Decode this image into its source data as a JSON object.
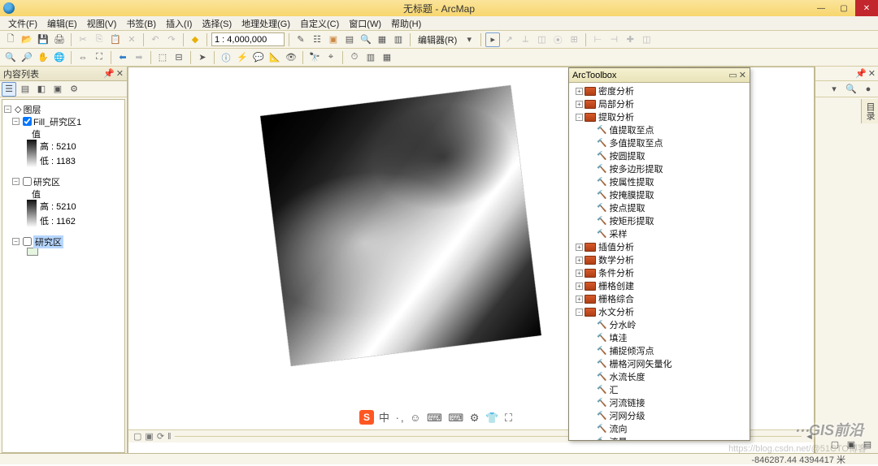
{
  "window": {
    "title": "无标题 - ArcMap",
    "min": "—",
    "max": "▢",
    "close": "✕"
  },
  "menu": [
    "文件(F)",
    "编辑(E)",
    "视图(V)",
    "书签(B)",
    "插入(I)",
    "选择(S)",
    "地理处理(G)",
    "自定义(C)",
    "窗口(W)",
    "帮助(H)"
  ],
  "toolbar1": {
    "scale": "1 : 4,000,000",
    "editor": "编辑器(R)"
  },
  "toc": {
    "title": "内容列表",
    "root": "图层",
    "layer1": {
      "name": "Fill_研究区1",
      "valLabel": "值",
      "highLabel": "高 : 5210",
      "lowLabel": "低 : 1183"
    },
    "layer2": {
      "name": "研究区",
      "valLabel": "值",
      "highLabel": "高 : 5210",
      "lowLabel": "低 : 1162"
    },
    "layer3": {
      "name": "研究区"
    }
  },
  "arctoolbox": {
    "title": "ArcToolbox",
    "groups": [
      {
        "exp": "+",
        "label": "密度分析"
      },
      {
        "exp": "+",
        "label": "局部分析"
      },
      {
        "exp": "-",
        "label": "提取分析",
        "tools": [
          "值提取至点",
          "多值提取至点",
          "按圆提取",
          "按多边形提取",
          "按属性提取",
          "按掩膜提取",
          "按点提取",
          "按矩形提取",
          "采样"
        ]
      },
      {
        "exp": "+",
        "label": "插值分析"
      },
      {
        "exp": "+",
        "label": "数学分析"
      },
      {
        "exp": "+",
        "label": "条件分析"
      },
      {
        "exp": "+",
        "label": "栅格创建"
      },
      {
        "exp": "+",
        "label": "栅格综合"
      },
      {
        "exp": "-",
        "label": "水文分析",
        "tools": [
          "分水岭",
          "填洼",
          "捕捉倾泻点",
          "栅格河网矢量化",
          "水流长度",
          "汇",
          "河流链接",
          "河网分级",
          "流向",
          "流量"
        ]
      }
    ]
  },
  "ime": {
    "logo": "S",
    "text": "中 ·, ☺ ⌨ ⌨ ⚙ 👕 ⛶"
  },
  "status": {
    "coords": "-846287.44  4394417 米"
  },
  "rightRail": {
    "tab": "目录"
  },
  "watermark": {
    "main": "⋯GIS前沿",
    "sub": "https://blog.csdn.net/@51CTO博客"
  }
}
